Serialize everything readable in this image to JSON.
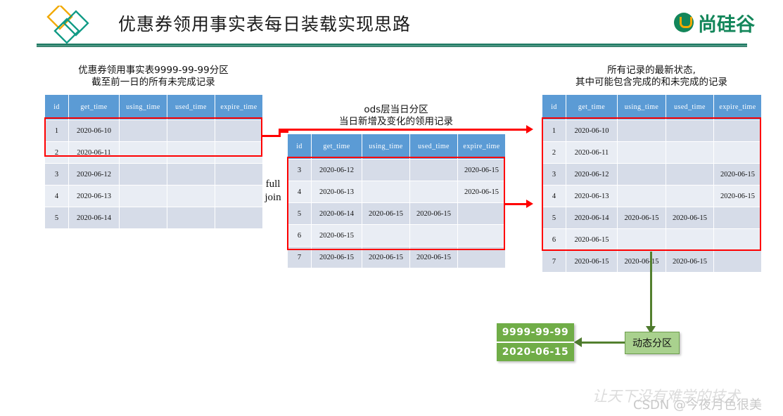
{
  "header": {
    "title": "优惠券领用事实表每日装载实现思路",
    "brand": "尚硅谷",
    "logo_left_name": "diamonds-logo",
    "logo_right_name": "atguigu-logo"
  },
  "columns": [
    "id",
    "get_time",
    "using_time",
    "used_time",
    "expire_time"
  ],
  "left_table": {
    "caption_line1": "优惠券领用事实表9999-99-99分区",
    "caption_line2": "截至前一日的所有未完成记录",
    "rows": [
      [
        "1",
        "2020-06-10",
        "",
        "",
        ""
      ],
      [
        "2",
        "2020-06-11",
        "",
        "",
        ""
      ],
      [
        "3",
        "2020-06-12",
        "",
        "",
        ""
      ],
      [
        "4",
        "2020-06-13",
        "",
        "",
        ""
      ],
      [
        "5",
        "2020-06-14",
        "",
        "",
        ""
      ]
    ]
  },
  "middle_table": {
    "caption_line1": "ods层当日分区",
    "caption_line2": "当日新增及变化的领用记录",
    "rows": [
      [
        "3",
        "2020-06-12",
        "",
        "",
        "2020-06-15"
      ],
      [
        "4",
        "2020-06-13",
        "",
        "",
        "2020-06-15"
      ],
      [
        "5",
        "2020-06-14",
        "2020-06-15",
        "2020-06-15",
        ""
      ],
      [
        "6",
        "2020-06-15",
        "",
        "",
        ""
      ],
      [
        "7",
        "2020-06-15",
        "2020-06-15",
        "2020-06-15",
        ""
      ]
    ]
  },
  "right_table": {
    "caption_line1": "所有记录的最新状态,",
    "caption_line2": "其中可能包含完成的和未完成的记录",
    "rows": [
      [
        "1",
        "2020-06-10",
        "",
        "",
        ""
      ],
      [
        "2",
        "2020-06-11",
        "",
        "",
        ""
      ],
      [
        "3",
        "2020-06-12",
        "",
        "",
        "2020-06-15"
      ],
      [
        "4",
        "2020-06-13",
        "",
        "",
        "2020-06-15"
      ],
      [
        "5",
        "2020-06-14",
        "2020-06-15",
        "2020-06-15",
        ""
      ],
      [
        "6",
        "2020-06-15",
        "",
        "",
        ""
      ],
      [
        "7",
        "2020-06-15",
        "2020-06-15",
        "2020-06-15",
        ""
      ]
    ]
  },
  "join_label": {
    "line1": "full",
    "line2": "join"
  },
  "partitions": {
    "box_top": "9999-99-99",
    "box_bottom": "2020-06-15",
    "dynamic_label": "动态分区"
  },
  "watermark": {
    "back": "让天下没有难学的技术",
    "front": "CSDN @今夜月色很美"
  },
  "colors": {
    "header_blue": "#5B9BD5",
    "row_odd": "#D6DCE8",
    "row_even": "#E9EDF4",
    "highlight_red": "#FF0000",
    "brand_green": "#13865a",
    "box_green": "#70ad47",
    "box_green_light": "#a9d18e",
    "rule_teal": "#1f7a63"
  }
}
